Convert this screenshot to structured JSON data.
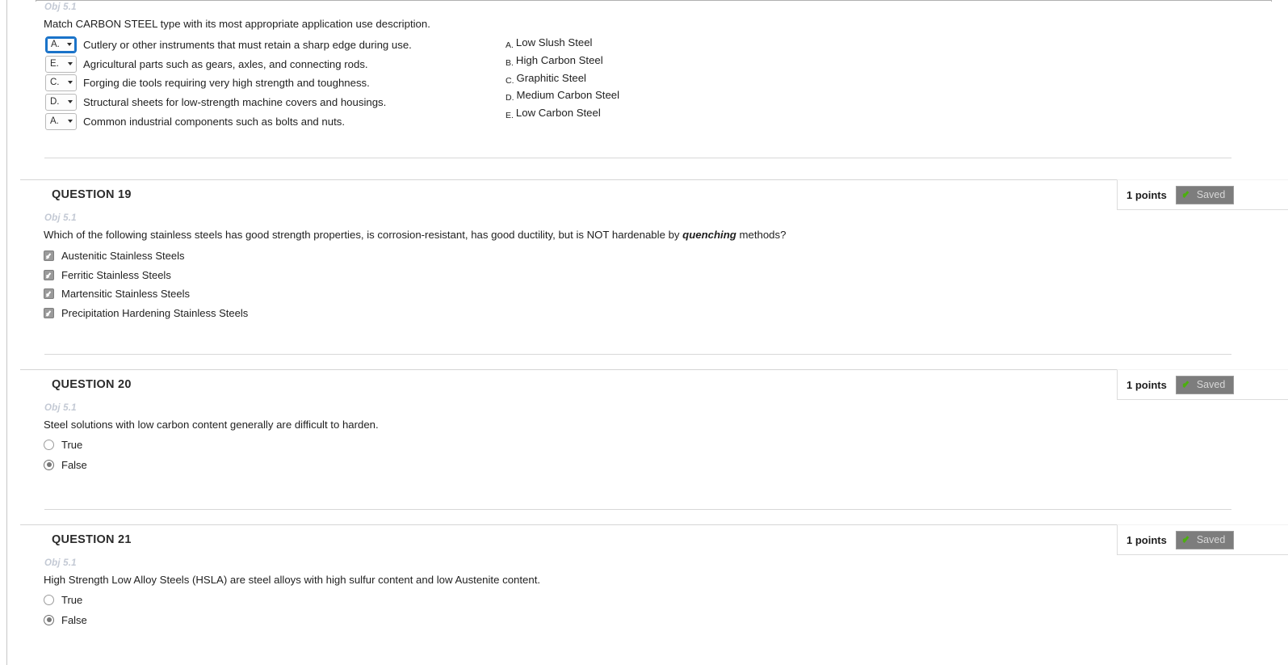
{
  "colors": {
    "accent_blue": "#1a73c9",
    "saved_badge_bg": "#7d7d7d",
    "saved_check_green": "#4caf0f",
    "obj_label": "#c3c9d4",
    "control_gray": "#9a9a9a"
  },
  "matching_question": {
    "obj_label": "Obj 5.1",
    "prompt": "Match CARBON STEEL type with its most appropriate application use description.",
    "rows": [
      {
        "selected": "A.",
        "description": "Cutlery or other instruments that must retain a sharp edge during use.",
        "focused": true
      },
      {
        "selected": "E.",
        "description": "Agricultural parts such as gears, axles, and connecting rods.",
        "focused": false
      },
      {
        "selected": "C.",
        "description": "Forging die tools requiring very high strength and toughness.",
        "focused": false
      },
      {
        "selected": "D.",
        "description": "Structural sheets for low-strength machine covers and housings.",
        "focused": false
      },
      {
        "selected": "A.",
        "description": "Common industrial components such as bolts and nuts.",
        "focused": false
      }
    ],
    "answer_choices": [
      {
        "letter": "A.",
        "text": "Low Slush Steel"
      },
      {
        "letter": "B.",
        "text": "High Carbon Steel"
      },
      {
        "letter": "C.",
        "text": "Graphitic Steel"
      },
      {
        "letter": "D.",
        "text": "Medium Carbon Steel"
      },
      {
        "letter": "E.",
        "text": "Low Carbon Steel"
      }
    ],
    "dropdown_options": [
      "A.",
      "B.",
      "C.",
      "D.",
      "E."
    ]
  },
  "question19": {
    "title": "QUESTION 19",
    "points": "1 points",
    "saved_label": "Saved",
    "obj_label": "Obj 5.1",
    "text_part1": "Which of the following stainless steels has good strength properties, is corrosion-resistant, has good ductility, but is NOT hardenable by ",
    "text_emphasis": "quenching",
    "text_part2": " methods?",
    "options": [
      {
        "label": "Austenitic Stainless Steels",
        "checked": true
      },
      {
        "label": "Ferritic Stainless Steels",
        "checked": true
      },
      {
        "label": "Martensitic Stainless Steels",
        "checked": true
      },
      {
        "label": "Precipitation Hardening Stainless Steels",
        "checked": true
      }
    ]
  },
  "question20": {
    "title": "QUESTION 20",
    "points": "1 points",
    "saved_label": "Saved",
    "obj_label": "Obj 5.1",
    "text": "Steel solutions with low carbon content generally are difficult to harden.",
    "options": [
      {
        "label": "True",
        "selected": false
      },
      {
        "label": "False",
        "selected": true
      }
    ]
  },
  "question21": {
    "title": "QUESTION 21",
    "points": "1 points",
    "saved_label": "Saved",
    "obj_label": "Obj 5.1",
    "text": "High Strength Low Alloy Steels (HSLA) are steel alloys with high sulfur content and low Austenite content.",
    "options": [
      {
        "label": "True",
        "selected": false
      },
      {
        "label": "False",
        "selected": true
      }
    ]
  }
}
